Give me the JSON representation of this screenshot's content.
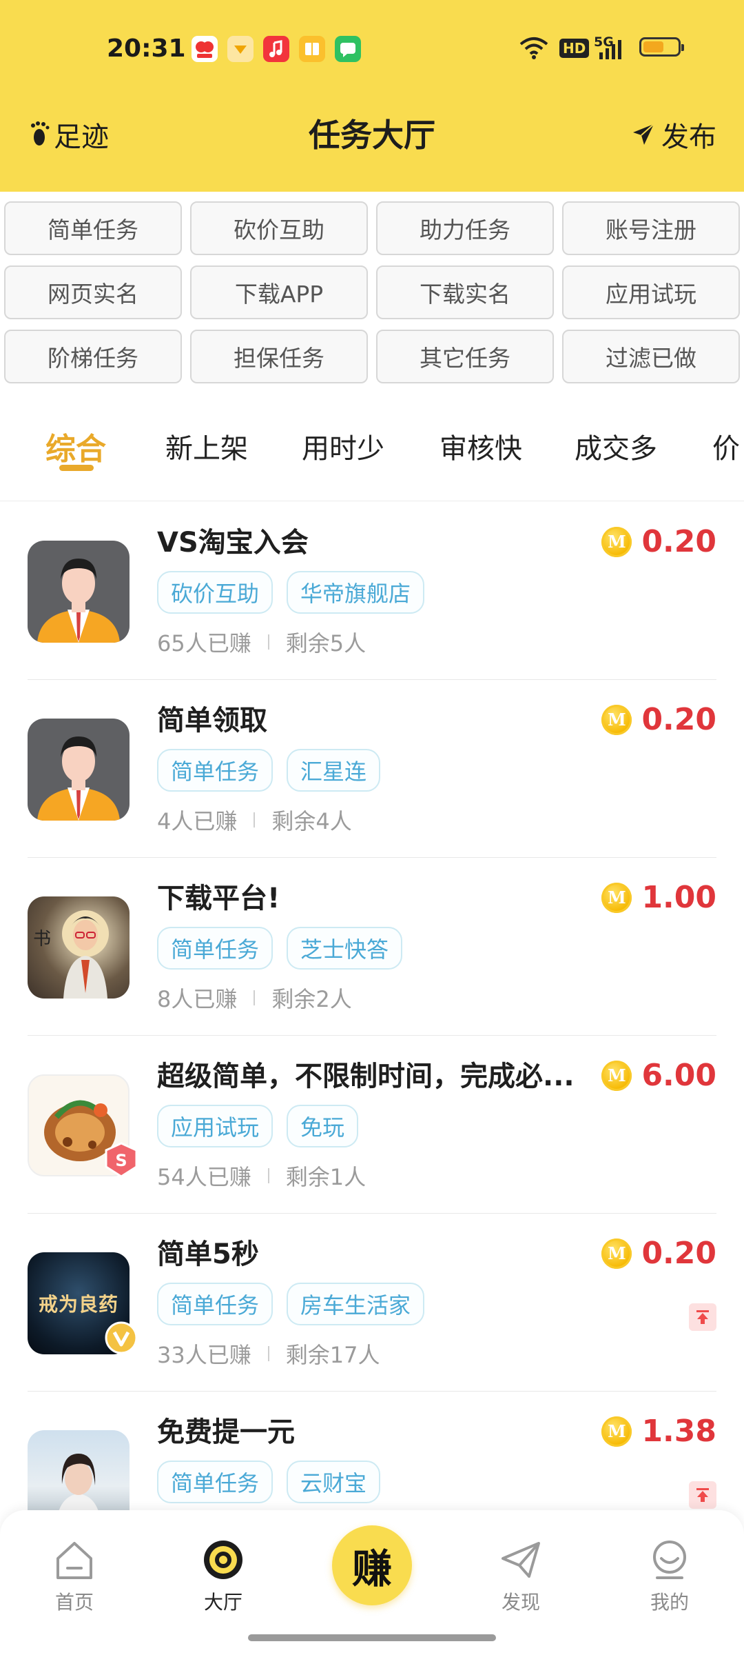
{
  "status": {
    "time": "20:31",
    "network": "5G",
    "hd": "HD",
    "battery_level": 0.6
  },
  "header": {
    "left_label": "足迹",
    "title": "任务大厅",
    "right_label": "发布",
    "bg_color": "#f9dc4f"
  },
  "categories": [
    "简单任务",
    "砍价互助",
    "助力任务",
    "账号注册",
    "网页实名",
    "下载APP",
    "下载实名",
    "应用试玩",
    "阶梯任务",
    "担保任务",
    "其它任务",
    "过滤已做"
  ],
  "sorts": [
    "综合",
    "新上架",
    "用时少",
    "审核快",
    "成交多",
    "价"
  ],
  "tasks": [
    {
      "title": "VS淘宝入会",
      "tags": [
        "砍价互助",
        "华帝旗舰店"
      ],
      "earned": "65人已赚",
      "remaining": "剩余5人",
      "amount": "0.20",
      "pinned": false
    },
    {
      "title": "简单领取",
      "tags": [
        "简单任务",
        "汇星连"
      ],
      "earned": "4人已赚",
      "remaining": "剩余4人",
      "amount": "0.20",
      "pinned": false
    },
    {
      "title": "下载平台!",
      "tags": [
        "简单任务",
        "芝士快答"
      ],
      "earned": "8人已赚",
      "remaining": "剩余2人",
      "amount": "1.00",
      "pinned": false
    },
    {
      "title": "超级简单，不限制时间，完成必...",
      "tags": [
        "应用试玩",
        "免玩"
      ],
      "earned": "54人已赚",
      "remaining": "剩余1人",
      "amount": "6.00",
      "pinned": false
    },
    {
      "title": "简单5秒",
      "tags": [
        "简单任务",
        "房车生活家"
      ],
      "earned": "33人已赚",
      "remaining": "剩余17人",
      "amount": "0.20",
      "pinned": true,
      "avatar_text": "戒为良药"
    },
    {
      "title": "免费提一元",
      "tags": [
        "简单任务",
        "云财宝"
      ],
      "earned": "",
      "remaining": "",
      "amount": "1.38",
      "pinned": true
    }
  ],
  "coin_letter": "M",
  "avatar_letter": "S",
  "bottom_nav": {
    "home": "首页",
    "hall": "大厅",
    "earn": "赚",
    "discover": "发现",
    "mine": "我的"
  },
  "colors": {
    "accent": "#e9a92a",
    "price": "#e0363b",
    "tag": "#4aa9d6"
  }
}
